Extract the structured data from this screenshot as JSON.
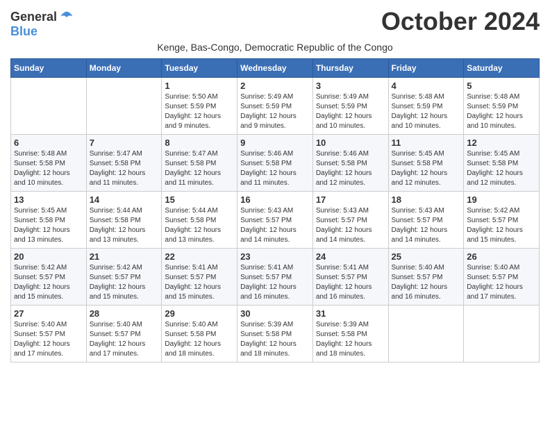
{
  "header": {
    "logo_general": "General",
    "logo_blue": "Blue",
    "month_title": "October 2024",
    "subtitle": "Kenge, Bas-Congo, Democratic Republic of the Congo"
  },
  "days_of_week": [
    "Sunday",
    "Monday",
    "Tuesday",
    "Wednesday",
    "Thursday",
    "Friday",
    "Saturday"
  ],
  "weeks": [
    [
      {
        "day": "",
        "info": ""
      },
      {
        "day": "",
        "info": ""
      },
      {
        "day": "1",
        "info": "Sunrise: 5:50 AM\nSunset: 5:59 PM\nDaylight: 12 hours and 9 minutes."
      },
      {
        "day": "2",
        "info": "Sunrise: 5:49 AM\nSunset: 5:59 PM\nDaylight: 12 hours and 9 minutes."
      },
      {
        "day": "3",
        "info": "Sunrise: 5:49 AM\nSunset: 5:59 PM\nDaylight: 12 hours and 10 minutes."
      },
      {
        "day": "4",
        "info": "Sunrise: 5:48 AM\nSunset: 5:59 PM\nDaylight: 12 hours and 10 minutes."
      },
      {
        "day": "5",
        "info": "Sunrise: 5:48 AM\nSunset: 5:59 PM\nDaylight: 12 hours and 10 minutes."
      }
    ],
    [
      {
        "day": "6",
        "info": "Sunrise: 5:48 AM\nSunset: 5:58 PM\nDaylight: 12 hours and 10 minutes."
      },
      {
        "day": "7",
        "info": "Sunrise: 5:47 AM\nSunset: 5:58 PM\nDaylight: 12 hours and 11 minutes."
      },
      {
        "day": "8",
        "info": "Sunrise: 5:47 AM\nSunset: 5:58 PM\nDaylight: 12 hours and 11 minutes."
      },
      {
        "day": "9",
        "info": "Sunrise: 5:46 AM\nSunset: 5:58 PM\nDaylight: 12 hours and 11 minutes."
      },
      {
        "day": "10",
        "info": "Sunrise: 5:46 AM\nSunset: 5:58 PM\nDaylight: 12 hours and 12 minutes."
      },
      {
        "day": "11",
        "info": "Sunrise: 5:45 AM\nSunset: 5:58 PM\nDaylight: 12 hours and 12 minutes."
      },
      {
        "day": "12",
        "info": "Sunrise: 5:45 AM\nSunset: 5:58 PM\nDaylight: 12 hours and 12 minutes."
      }
    ],
    [
      {
        "day": "13",
        "info": "Sunrise: 5:45 AM\nSunset: 5:58 PM\nDaylight: 12 hours and 13 minutes."
      },
      {
        "day": "14",
        "info": "Sunrise: 5:44 AM\nSunset: 5:58 PM\nDaylight: 12 hours and 13 minutes."
      },
      {
        "day": "15",
        "info": "Sunrise: 5:44 AM\nSunset: 5:58 PM\nDaylight: 12 hours and 13 minutes."
      },
      {
        "day": "16",
        "info": "Sunrise: 5:43 AM\nSunset: 5:57 PM\nDaylight: 12 hours and 14 minutes."
      },
      {
        "day": "17",
        "info": "Sunrise: 5:43 AM\nSunset: 5:57 PM\nDaylight: 12 hours and 14 minutes."
      },
      {
        "day": "18",
        "info": "Sunrise: 5:43 AM\nSunset: 5:57 PM\nDaylight: 12 hours and 14 minutes."
      },
      {
        "day": "19",
        "info": "Sunrise: 5:42 AM\nSunset: 5:57 PM\nDaylight: 12 hours and 15 minutes."
      }
    ],
    [
      {
        "day": "20",
        "info": "Sunrise: 5:42 AM\nSunset: 5:57 PM\nDaylight: 12 hours and 15 minutes."
      },
      {
        "day": "21",
        "info": "Sunrise: 5:42 AM\nSunset: 5:57 PM\nDaylight: 12 hours and 15 minutes."
      },
      {
        "day": "22",
        "info": "Sunrise: 5:41 AM\nSunset: 5:57 PM\nDaylight: 12 hours and 15 minutes."
      },
      {
        "day": "23",
        "info": "Sunrise: 5:41 AM\nSunset: 5:57 PM\nDaylight: 12 hours and 16 minutes."
      },
      {
        "day": "24",
        "info": "Sunrise: 5:41 AM\nSunset: 5:57 PM\nDaylight: 12 hours and 16 minutes."
      },
      {
        "day": "25",
        "info": "Sunrise: 5:40 AM\nSunset: 5:57 PM\nDaylight: 12 hours and 16 minutes."
      },
      {
        "day": "26",
        "info": "Sunrise: 5:40 AM\nSunset: 5:57 PM\nDaylight: 12 hours and 17 minutes."
      }
    ],
    [
      {
        "day": "27",
        "info": "Sunrise: 5:40 AM\nSunset: 5:57 PM\nDaylight: 12 hours and 17 minutes."
      },
      {
        "day": "28",
        "info": "Sunrise: 5:40 AM\nSunset: 5:57 PM\nDaylight: 12 hours and 17 minutes."
      },
      {
        "day": "29",
        "info": "Sunrise: 5:40 AM\nSunset: 5:58 PM\nDaylight: 12 hours and 18 minutes."
      },
      {
        "day": "30",
        "info": "Sunrise: 5:39 AM\nSunset: 5:58 PM\nDaylight: 12 hours and 18 minutes."
      },
      {
        "day": "31",
        "info": "Sunrise: 5:39 AM\nSunset: 5:58 PM\nDaylight: 12 hours and 18 minutes."
      },
      {
        "day": "",
        "info": ""
      },
      {
        "day": "",
        "info": ""
      }
    ]
  ]
}
